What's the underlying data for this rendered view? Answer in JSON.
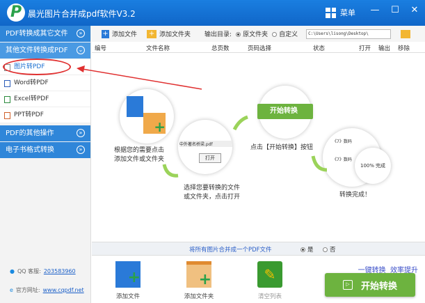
{
  "app": {
    "logo_letter": "P",
    "title": "晨光图片合并成pdf软件V3.2",
    "menu_label": "菜单",
    "minimize": "—",
    "maximize": "☐",
    "close": "✕"
  },
  "sidebar": {
    "sections": [
      {
        "label": "PDF转换成其它文件",
        "chevron": "»"
      },
      {
        "label": "其他文件转换成PDF",
        "chevron": "⌄"
      },
      {
        "label": "PDF的其他操作",
        "chevron": "»"
      },
      {
        "label": "电子书格式转换",
        "chevron": "»"
      }
    ],
    "subitems": [
      {
        "label": "图片转PDF"
      },
      {
        "label": "Word转PDF"
      },
      {
        "label": "Excel转PDF"
      },
      {
        "label": "PPT转PDF"
      }
    ],
    "qq_label": "QQ 客服:",
    "qq_value": "203583960",
    "site_label": "官方网址:",
    "site_value": "www.cqpdf.net"
  },
  "toolbar": {
    "add_file": "添加文件",
    "add_folder": "添加文件夹",
    "output_label": "输出目录:",
    "opt_source": "原文件夹",
    "opt_custom": "自定义",
    "path": "C:\\Users\\lisong\\Desktop\\"
  },
  "table": {
    "columns": [
      "编号",
      "文件名称",
      "总页数",
      "页码选择",
      "状态",
      "打开",
      "输出",
      "移除"
    ]
  },
  "guide": {
    "step1": "根据您的需要点击\n添加文件或文件夹",
    "step2": "选择您要转换的文件\n或文件夹，点击打开",
    "step3": "点击【开始转换】按钮",
    "step4": "转换完成！",
    "mock_file": "中外著名桥梁.pdf",
    "mock_open": "打开",
    "mock_start": "开始转换",
    "mock_percent": "100%",
    "mock_done": "完成",
    "mock_doc": "《7》数码"
  },
  "merge": {
    "label": "将所有图片合并成一个PDF文件",
    "yes": "是",
    "no": "否"
  },
  "bottom": {
    "add_file": "添加文件",
    "add_folder": "添加文件夹",
    "clear": "清空列表",
    "slogan": "一键转换  效率提升",
    "start": "开始转换"
  }
}
